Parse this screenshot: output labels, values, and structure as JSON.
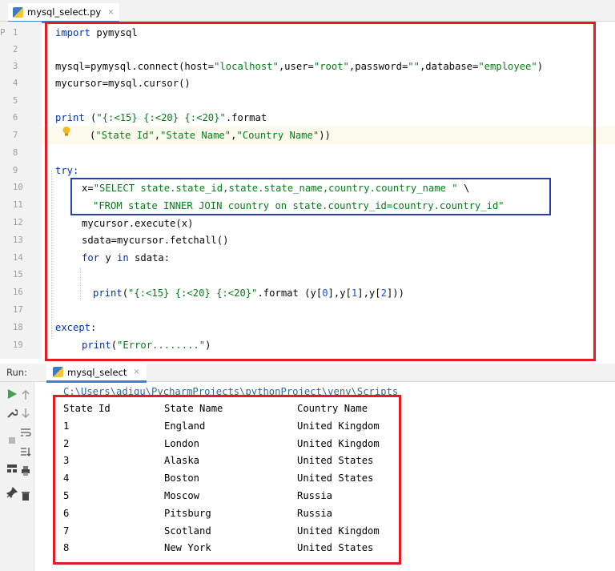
{
  "editor_tab": {
    "filename": "mysql_select.py",
    "close_glyph": "×"
  },
  "gutter": {
    "left_fragment": "P"
  },
  "line_numbers": [
    "1",
    "2",
    "3",
    "4",
    "5",
    "6",
    "7",
    "8",
    "9",
    "10",
    "11",
    "12",
    "13",
    "14",
    "15",
    "16",
    "17",
    "18",
    "19"
  ],
  "code": {
    "l1_kw": "import",
    "l1_rest": " pymysql",
    "l3_a": "mysql=pymysql.connect(host=",
    "l3_s1": "\"localhost\"",
    "l3_b": ",user=",
    "l3_s2": "\"root\"",
    "l3_c": ",password=",
    "l3_s3": "\"\"",
    "l3_d": ",database=",
    "l3_s4": "\"employee\"",
    "l3_e": ")",
    "l4": "mycursor=mysql.cursor()",
    "l6_kw": "print",
    "l6_a": " (",
    "l6_s": "\"{:<15} {:<20} {:<20}\"",
    "l6_b": ".format",
    "l7_a": "(",
    "l7_s1": "\"State Id\"",
    "l7_b": ",",
    "l7_s2": "\"State Name\"",
    "l7_c": ",",
    "l7_s3": "\"Country Name\"",
    "l7_d": "))",
    "l9": "try:",
    "l10_a": "x=",
    "l10_s": "\"SELECT state.state_id,state.state_name,country.country_name \"",
    "l10_b": " \\",
    "l11_s": "\"FROM state INNER JOIN country on state.country_id=country.country_id\"",
    "l12": "mycursor.execute(x)",
    "l13": "sdata=mycursor.fetchall()",
    "l14_kw1": "for",
    "l14_a": " y ",
    "l14_kw2": "in",
    "l14_b": " sdata:",
    "l16_kw": "print",
    "l16_a": "(",
    "l16_s": "\"{:<15} {:<20} {:<20}\"",
    "l16_b": ".format (y[",
    "l16_n0": "0",
    "l16_c": "],y[",
    "l16_n1": "1",
    "l16_d": "],y[",
    "l16_n2": "2",
    "l16_e": "]))",
    "l18_kw": "except",
    "l18_a": ":",
    "l19_kw": "print",
    "l19_a": "(",
    "l19_s": "\"Error........\"",
    "l19_b": ")"
  },
  "run_panel": {
    "label": "Run:",
    "tab_name": "mysql_select",
    "close_glyph": "×",
    "command": "C:\\Users\\adigu\\PycharmProjects\\pythonProject\\venv\\Scripts",
    "header": [
      "State Id",
      "State Name",
      "Country Name"
    ],
    "rows": [
      [
        "1",
        "England",
        "United Kingdom"
      ],
      [
        "2",
        "London",
        "United Kingdom"
      ],
      [
        "3",
        "Alaska",
        "United States"
      ],
      [
        "4",
        "Boston",
        "United States"
      ],
      [
        "5",
        "Moscow",
        "Russia"
      ],
      [
        "6",
        "Pitsburg",
        "Russia"
      ],
      [
        "7",
        "Scotland",
        "United Kingdom"
      ],
      [
        "8",
        "New York",
        "United States"
      ]
    ],
    "icons": [
      "run-icon",
      "up-arrow-icon",
      "wrench-icon",
      "down-arrow-icon",
      "stop-icon",
      "soft-wrap-icon",
      "scroll-to-end-icon",
      "layout-icon",
      "print-icon",
      "pin-icon",
      "trash-icon"
    ]
  },
  "colors": {
    "keyword": "#0033b3",
    "string": "#067d17",
    "number": "#1750eb",
    "red_box": "#e21b25",
    "blue_box": "#2b3fa8",
    "tab_underline": "#4083c9"
  }
}
